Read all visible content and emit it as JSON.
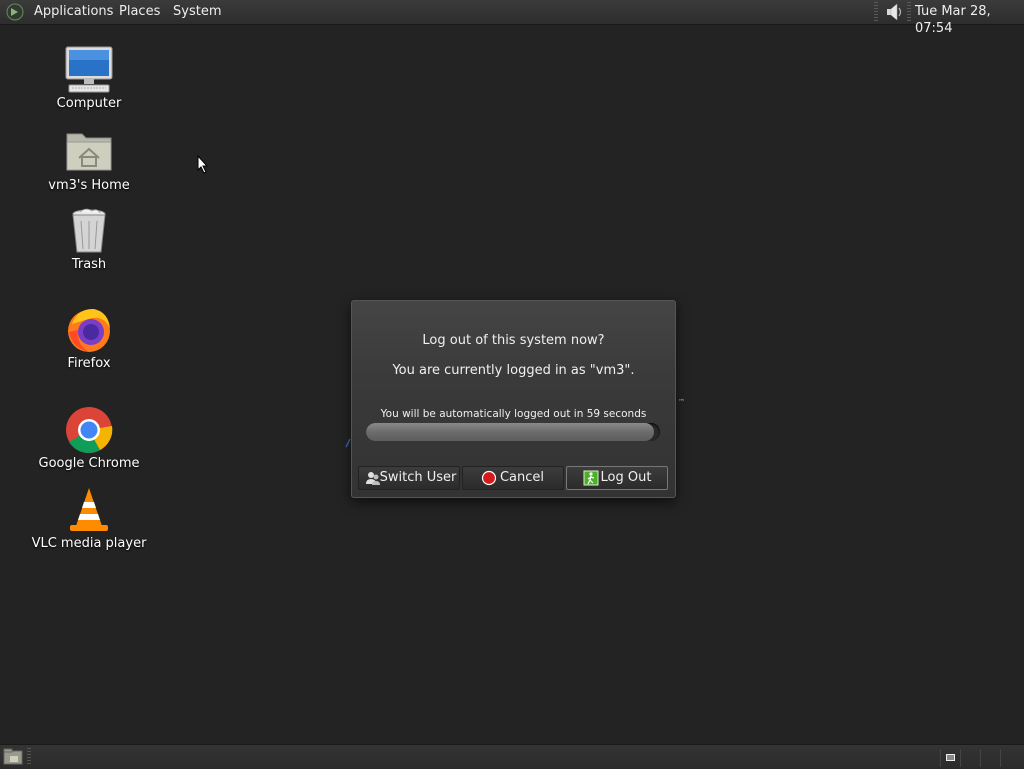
{
  "top_panel": {
    "menus": [
      "Applications",
      "Places",
      "System"
    ],
    "clock": "Tue Mar 28, 07:54",
    "icons": [
      "distributor-logo-icon",
      "volume-icon"
    ]
  },
  "desktop": {
    "icons": [
      {
        "label": "Computer",
        "icon": "computer-icon"
      },
      {
        "label": "vm3's Home",
        "icon": "home-folder-icon"
      },
      {
        "label": "Trash",
        "icon": "trash-icon"
      },
      {
        "label": "Firefox",
        "icon": "firefox-icon"
      },
      {
        "label": "Google Chrome",
        "icon": "chrome-icon"
      },
      {
        "label": "VLC media player",
        "icon": "vlc-icon"
      }
    ]
  },
  "logout_dialog": {
    "question": "Log out of this system now?",
    "user_message": "You are currently logged in as \"vm3\".",
    "countdown": "You will be automatically logged out in 59 seconds",
    "progress_fraction": 0.98,
    "buttons": {
      "switch_user": "Switch User",
      "cancel": "Cancel",
      "log_out": "Log Out"
    }
  },
  "background_window": {
    "tm_mark": "™"
  },
  "colors": {
    "desktop_bg": "#222322",
    "panel_bg": "#333433",
    "cancel_red": "#d41a1a",
    "logout_green": "#4caf2a"
  }
}
